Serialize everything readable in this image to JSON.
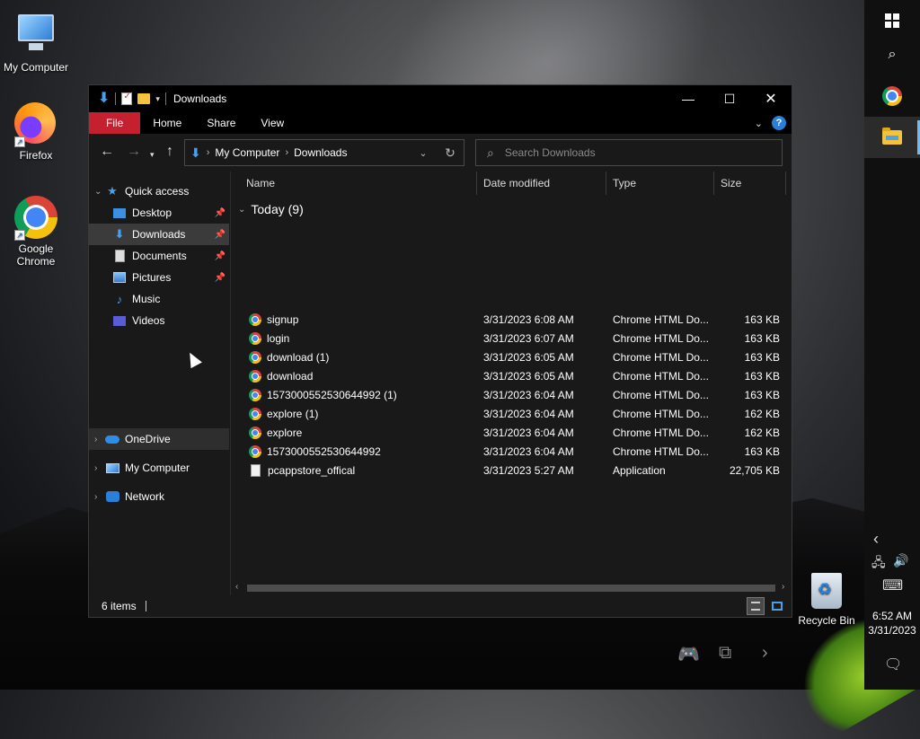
{
  "desktop": {
    "icons": [
      {
        "label": "My Computer"
      },
      {
        "label": "Firefox"
      },
      {
        "label": "Google Chrome"
      }
    ],
    "recycle_bin": "Recycle Bin"
  },
  "taskbar": {
    "time": "6:52 AM",
    "date": "3/31/2023"
  },
  "window": {
    "title": "Downloads",
    "ribbon_tabs": [
      "File",
      "Home",
      "Share",
      "View"
    ],
    "address": {
      "segments": [
        "My Computer",
        "Downloads"
      ]
    },
    "search": {
      "placeholder": "Search Downloads"
    },
    "nav": {
      "quick_access": "Quick access",
      "items": [
        {
          "label": "Desktop",
          "icon": "desktop-folder-icon",
          "pinned": true
        },
        {
          "label": "Downloads",
          "icon": "downloads-folder-icon",
          "pinned": true
        },
        {
          "label": "Documents",
          "icon": "documents-folder-icon",
          "pinned": true
        },
        {
          "label": "Pictures",
          "icon": "pictures-folder-icon",
          "pinned": true
        },
        {
          "label": "Music",
          "icon": "music-folder-icon",
          "pinned": false
        },
        {
          "label": "Videos",
          "icon": "videos-folder-icon",
          "pinned": false
        }
      ],
      "onedrive": "OneDrive",
      "my_computer": "My Computer",
      "network": "Network"
    },
    "columns": [
      "Name",
      "Date modified",
      "Type",
      "Size"
    ],
    "group_label": "Today (9)",
    "files": [
      {
        "name": "signup",
        "date": "3/31/2023 6:08 AM",
        "type": "Chrome HTML Do...",
        "size": "163 KB",
        "icon": "chrome-file-icon"
      },
      {
        "name": "login",
        "date": "3/31/2023 6:07 AM",
        "type": "Chrome HTML Do...",
        "size": "163 KB",
        "icon": "chrome-file-icon"
      },
      {
        "name": "download (1)",
        "date": "3/31/2023 6:05 AM",
        "type": "Chrome HTML Do...",
        "size": "163 KB",
        "icon": "chrome-file-icon"
      },
      {
        "name": "download",
        "date": "3/31/2023 6:05 AM",
        "type": "Chrome HTML Do...",
        "size": "163 KB",
        "icon": "chrome-file-icon"
      },
      {
        "name": "1573000552530644992 (1)",
        "date": "3/31/2023 6:04 AM",
        "type": "Chrome HTML Do...",
        "size": "163 KB",
        "icon": "chrome-file-icon"
      },
      {
        "name": "explore (1)",
        "date": "3/31/2023 6:04 AM",
        "type": "Chrome HTML Do...",
        "size": "162 KB",
        "icon": "chrome-file-icon"
      },
      {
        "name": "explore",
        "date": "3/31/2023 6:04 AM",
        "type": "Chrome HTML Do...",
        "size": "162 KB",
        "icon": "chrome-file-icon"
      },
      {
        "name": "1573000552530644992",
        "date": "3/31/2023 6:04 AM",
        "type": "Chrome HTML Do...",
        "size": "163 KB",
        "icon": "chrome-file-icon"
      },
      {
        "name": "pcappstore_offical",
        "date": "3/31/2023 5:27 AM",
        "type": "Application",
        "size": "22,705 KB",
        "icon": "application-file-icon"
      }
    ],
    "status": "6 items"
  },
  "colors": {
    "file_tab": "#c4202f",
    "accent": "#4a9fe6",
    "window_bg": "#191919",
    "selected": "#3b3b3b"
  }
}
